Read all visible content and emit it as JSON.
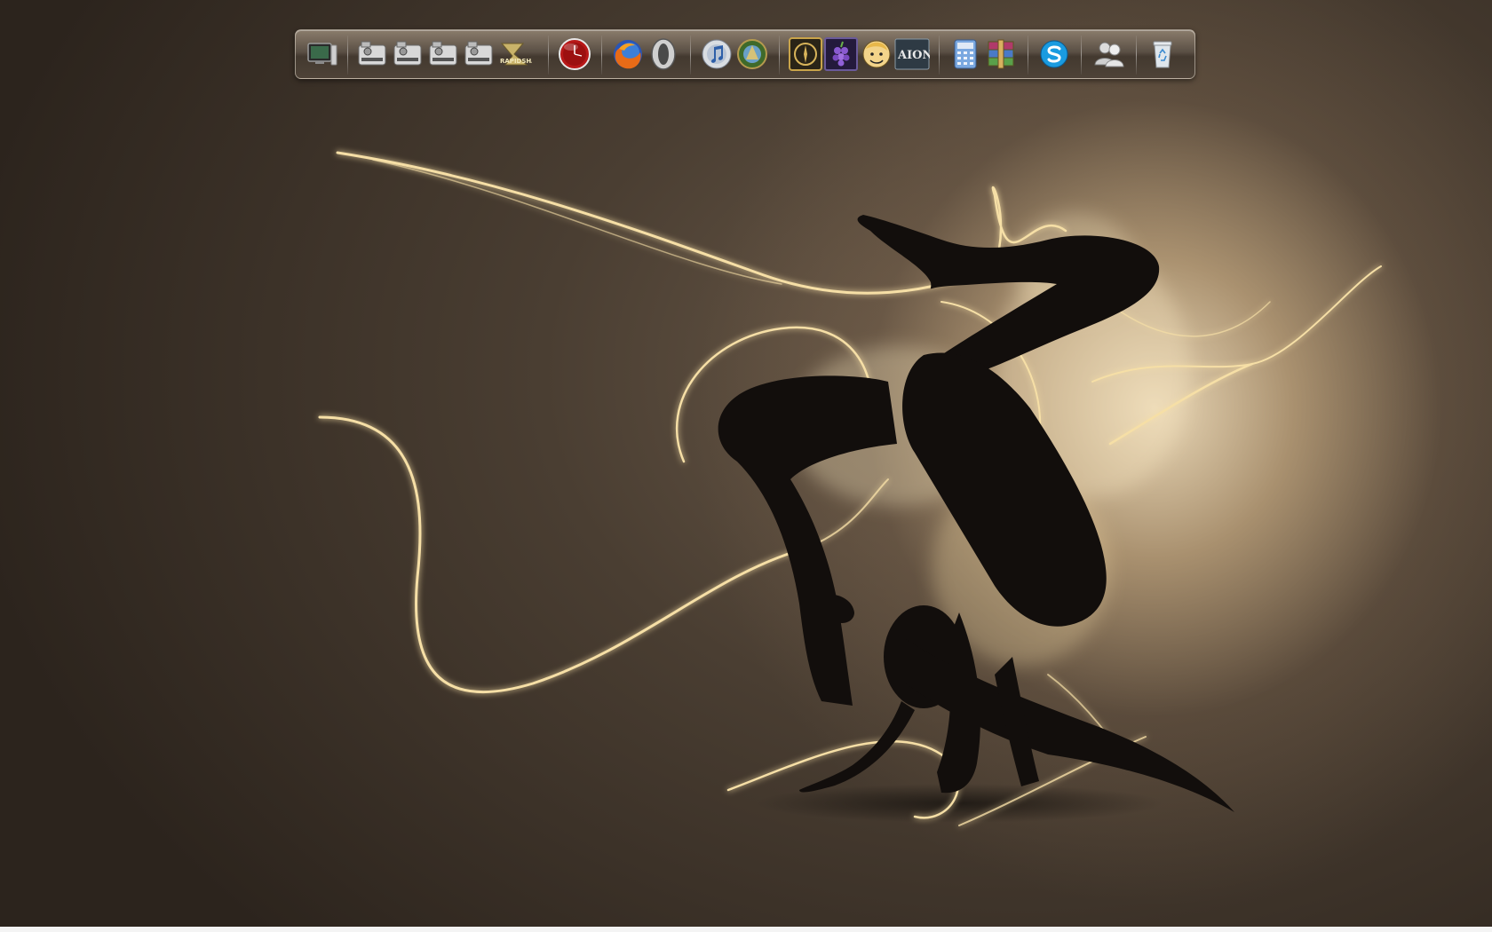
{
  "desktop": {
    "wallpaper": "dancer-silhouette-light-streaks",
    "colors": {
      "background_dark": "#2c241d",
      "background_glow": "#f0debc",
      "light_streak": "#f6dfa6",
      "silhouette": "#120e0c"
    }
  },
  "dock": {
    "items": [
      {
        "name": "my-computer-icon"
      },
      {
        "name": "drive-icon-1"
      },
      {
        "name": "drive-icon-2"
      },
      {
        "name": "drive-icon-3"
      },
      {
        "name": "drive-icon-4"
      },
      {
        "name": "rapidshare-icon",
        "label": "RAPIDSHARE"
      },
      {
        "name": "clock-icon"
      },
      {
        "name": "firefox-icon"
      },
      {
        "name": "opera-icon"
      },
      {
        "name": "itunes-icon"
      },
      {
        "name": "world-of-warcraft-icon"
      },
      {
        "name": "game-icon-emblem"
      },
      {
        "name": "game-icon-grapes"
      },
      {
        "name": "fallout-vault-boy-icon"
      },
      {
        "name": "aion-icon",
        "label": "AION"
      },
      {
        "name": "calculator-icon"
      },
      {
        "name": "winrar-icon"
      },
      {
        "name": "skype-icon"
      },
      {
        "name": "messenger-icon"
      },
      {
        "name": "recycle-bin-icon"
      }
    ]
  }
}
